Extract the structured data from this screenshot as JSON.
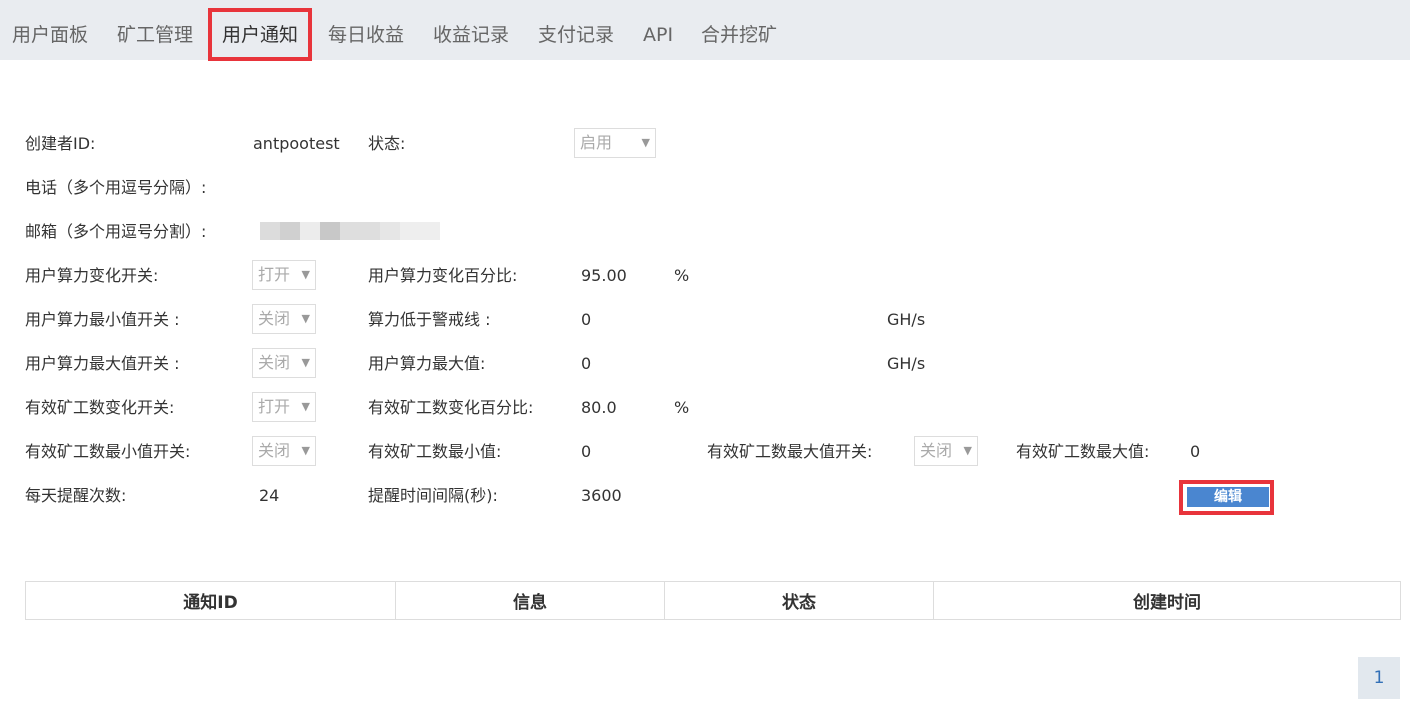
{
  "nav": {
    "tabs": [
      {
        "label": "用户面板"
      },
      {
        "label": "矿工管理"
      },
      {
        "label": "用户通知",
        "active": true
      },
      {
        "label": "每日收益"
      },
      {
        "label": "收益记录"
      },
      {
        "label": "支付记录"
      },
      {
        "label": "API"
      },
      {
        "label": "合并挖矿"
      }
    ]
  },
  "form": {
    "creator_id": {
      "label": "创建者ID:",
      "value": "antpootest"
    },
    "status": {
      "label": "状态:",
      "value": "启用"
    },
    "phone": {
      "label": "电话（多个用逗号分隔）:"
    },
    "email": {
      "label": "邮箱（多个用逗号分割）:"
    },
    "hashrate_change_switch": {
      "label": "用户算力变化开关:",
      "value": "打开"
    },
    "hashrate_change_pct": {
      "label": "用户算力变化百分比:",
      "value": "95.00",
      "unit": "%"
    },
    "hashrate_min_switch": {
      "label": "用户算力最小值开关 :",
      "value": "关闭"
    },
    "hashrate_alert_line": {
      "label": "算力低于警戒线 :",
      "value": "0",
      "unit": "GH/s"
    },
    "hashrate_max_switch": {
      "label": "用户算力最大值开关 :",
      "value": "关闭"
    },
    "hashrate_max": {
      "label": "用户算力最大值:",
      "value": "0",
      "unit": "GH/s"
    },
    "worker_change_switch": {
      "label": "有效矿工数变化开关:",
      "value": "打开"
    },
    "worker_change_pct": {
      "label": "有效矿工数变化百分比:",
      "value": "80.0",
      "unit": "%"
    },
    "worker_min_switch": {
      "label": "有效矿工数最小值开关:",
      "value": "关闭"
    },
    "worker_min": {
      "label": "有效矿工数最小值:",
      "value": "0"
    },
    "worker_max_switch": {
      "label": "有效矿工数最大值开关:",
      "value": "关闭"
    },
    "worker_max": {
      "label": "有效矿工数最大值:",
      "value": "0"
    },
    "daily_reminders": {
      "label": "每天提醒次数:",
      "value": "24"
    },
    "reminder_interval": {
      "label": "提醒时间间隔(秒):",
      "value": "3600"
    },
    "edit_button": "编辑"
  },
  "table": {
    "headers": [
      "通知ID",
      "信息",
      "状态",
      "创建时间"
    ]
  },
  "pagination": {
    "current_page": "1"
  },
  "colors": {
    "nav_background": "#e9ecf0",
    "highlight_border": "#e8343b",
    "edit_button": "#4a86d0",
    "pager_background": "#e2e8ee"
  }
}
